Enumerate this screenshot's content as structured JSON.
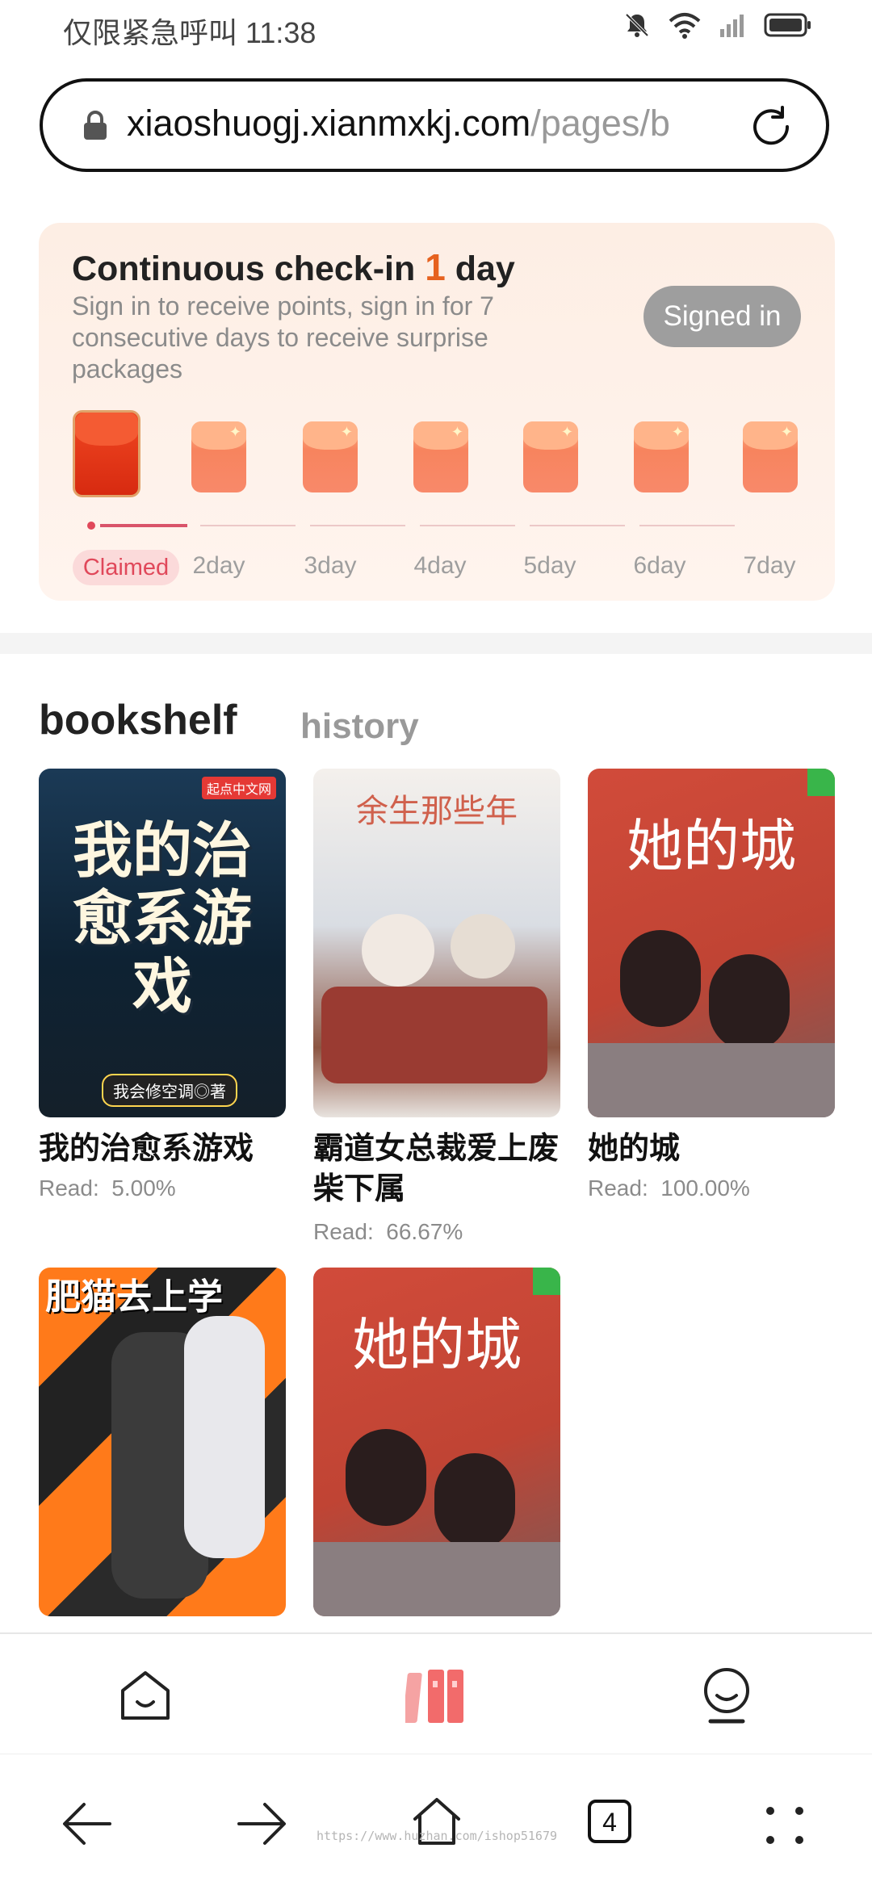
{
  "status_bar": {
    "left_text": "仅限紧急呼叫",
    "time": "11:38",
    "icons": [
      "bell-muted-icon",
      "wifi-icon",
      "signal-icon",
      "battery-icon"
    ]
  },
  "url_bar": {
    "host": "xiaoshuogj.xianmxkj.com",
    "path": "/pages/b"
  },
  "checkin": {
    "title_prefix": "Continuous check-in ",
    "days": "1",
    "title_suffix": " day",
    "description": "Sign in to receive points, sign in for 7 consecutive days to receive surprise packages",
    "signed_label": "Signed in",
    "claimed_label": "Claimed",
    "day_labels": [
      "2day",
      "3day",
      "4day",
      "5day",
      "6day",
      "7day"
    ],
    "accent_color": "#e6621f"
  },
  "tabs": {
    "active": "bookshelf",
    "inactive": "history"
  },
  "books": [
    {
      "title": "我的治愈系游戏",
      "read_label": "Read:",
      "read_value": "5.00%",
      "cover_text": "我的治愈系游戏",
      "cover_author": "我会修空调◎著",
      "cover_brand": "起点中文网"
    },
    {
      "title": "霸道女总裁爱上废柴下属",
      "read_label": "Read:",
      "read_value": "66.67%",
      "cover_text": "余生那些年"
    },
    {
      "title": "她的城",
      "read_label": "Read:",
      "read_value": "100.00%",
      "cover_text": "她的城"
    },
    {
      "title": "",
      "cover_text": "肥猫去上学"
    },
    {
      "title": "",
      "cover_text": "她的城"
    }
  ],
  "bottom_nav": {
    "items": [
      "home-icon",
      "bookshelf-icon",
      "profile-icon"
    ],
    "active_color": "#f26b6b"
  },
  "browser_nav": {
    "tab_count": "4",
    "watermark": "https://www.huzhan.com/ishop51679"
  }
}
